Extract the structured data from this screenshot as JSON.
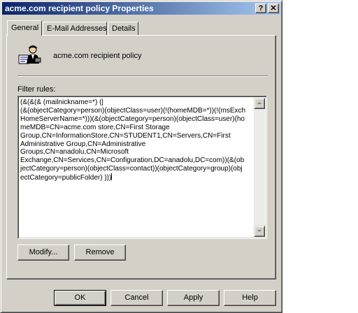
{
  "window": {
    "title": "acme.com recipient policy Properties",
    "help_button": "?",
    "close_button": "✕"
  },
  "tabs": [
    {
      "label": "General",
      "active": true
    },
    {
      "label": "E-Mail Addresses",
      "active": false
    },
    {
      "label": "Details",
      "active": false
    }
  ],
  "general": {
    "policy_name": "acme.com recipient policy",
    "policy_icon": "recipient-policy-icon",
    "filter_label": "Filter rules:",
    "filter_text_lines": [
      "(&(&(& (mailnickname=*) (|",
      "(&(objectCategory=person)(objectClass=user)(!(homeMDB=*))(!(msExch",
      "HomeServerName=*)))(&(objectCategory=person)(objectClass=user)(ho",
      "meMDB=CN=acme.com store,CN=First Storage",
      "Group,CN=InformationStore,CN=STUDENT1,CN=Servers,CN=First",
      "Administrative Group,CN=Administrative",
      "Groups,CN=anadolu,CN=Microsoft",
      "Exchange,CN=Services,CN=Configuration,DC=anadolu,DC=com))(&(ob",
      "jectCategory=person)(objectClass=contact))(objectCategory=group)(obj",
      "ectCategory=publicFolder) )))"
    ],
    "modify_button": "Modify...",
    "remove_button": "Remove"
  },
  "footer": {
    "ok": "OK",
    "cancel": "Cancel",
    "apply": "Apply",
    "help": "Help"
  },
  "colors": {
    "face": "#d4d0c8",
    "title_start": "#0a246a",
    "title_end": "#a6caf0"
  }
}
